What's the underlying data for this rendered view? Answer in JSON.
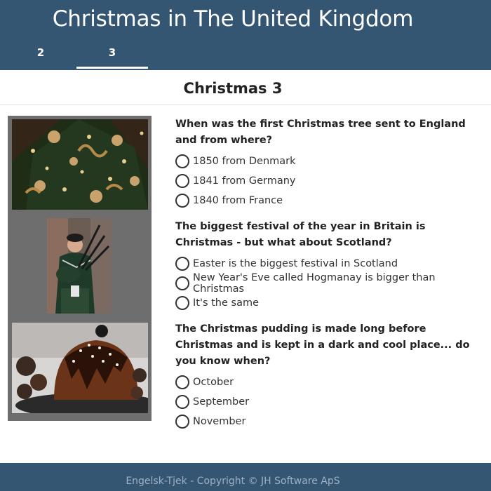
{
  "header": {
    "title": "Christmas in The United Kingdom",
    "tabs": [
      {
        "label": "2"
      },
      {
        "label": "3"
      }
    ]
  },
  "page": {
    "title": "Christmas 3"
  },
  "images": [
    {
      "icon": "christmas-tree-photo"
    },
    {
      "icon": "bagpiper-photo"
    },
    {
      "icon": "christmas-pudding-photo"
    }
  ],
  "questions": [
    {
      "text": "When was the first Christmas tree sent to England and from where?",
      "options": [
        "1850 from Denmark",
        "1841 from Germany",
        "1840 from France"
      ]
    },
    {
      "text": "The biggest festival of the year in Britain is Christmas - but what about Scotland?",
      "options": [
        "Easter is the biggest festival in Scotland",
        "New Year's Eve called Hogmanay is bigger than Christmas",
        "It's the same"
      ]
    },
    {
      "text": "The Christmas pudding is made long before Christmas and is kept in a dark and cool place... do you know when?",
      "options": [
        "October",
        "September",
        "November"
      ]
    }
  ],
  "footer": {
    "text": "Engelsk-Tjek - Copyright © JH Software ApS"
  },
  "colors": {
    "header_bg": "#345672",
    "footer_text": "#9eb0c3",
    "image_panel": "#6e6e6e"
  }
}
